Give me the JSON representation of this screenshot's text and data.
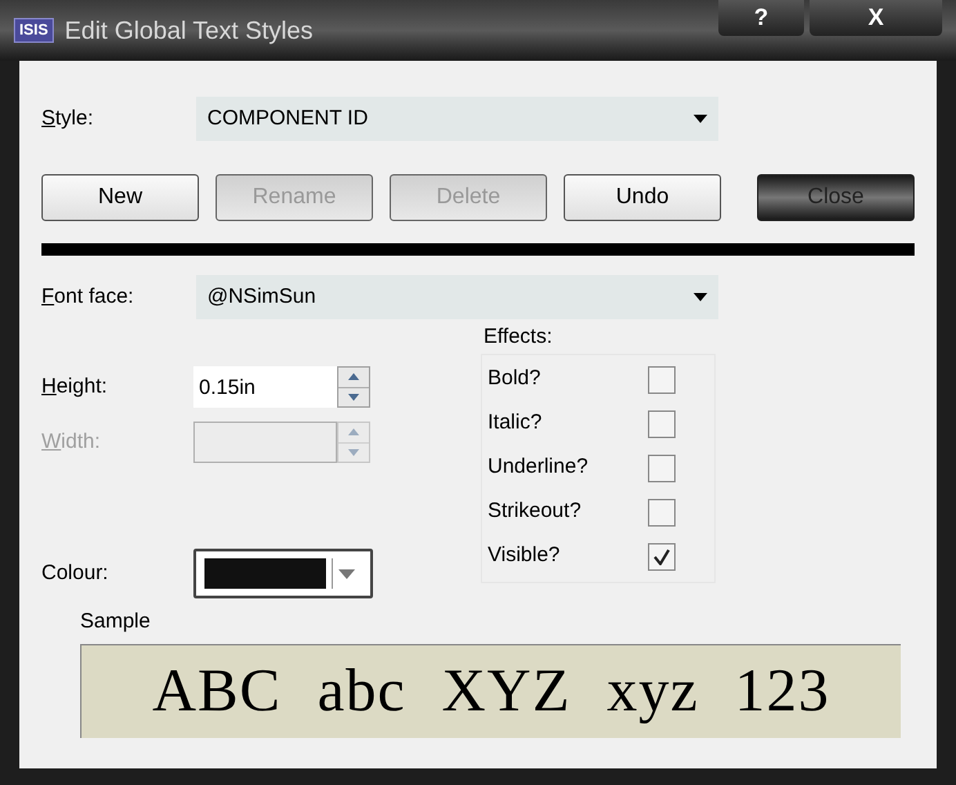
{
  "window": {
    "title": "Edit Global Text Styles",
    "logo": "ISIS",
    "help": "?",
    "close": "X"
  },
  "style": {
    "label": "Style:",
    "mnemonic": true,
    "value": "COMPONENT ID"
  },
  "buttons": [
    {
      "label": "New",
      "disabled": false,
      "focused": false
    },
    {
      "label": "Rename",
      "disabled": true,
      "focused": false
    },
    {
      "label": "Delete",
      "disabled": true,
      "focused": false
    },
    {
      "label": "Undo",
      "disabled": false,
      "focused": false
    },
    {
      "label": "Close",
      "disabled": false,
      "focused": true
    }
  ],
  "font_face": {
    "label": "Font face:",
    "mnemonic": true,
    "value": "@NSimSun"
  },
  "height": {
    "label": "Height:",
    "mnemonic": true,
    "value": "0.15in",
    "disabled": false
  },
  "width": {
    "label": "Width:",
    "mnemonic": true,
    "disabled": true
  },
  "colour": {
    "label": "Colour:",
    "mnemonic": false,
    "color": "#111111"
  },
  "effects": {
    "title": "Effects:",
    "items": [
      {
        "label": "Bold?",
        "checked": false
      },
      {
        "label": "Italic?",
        "checked": false
      },
      {
        "label": "Underline?",
        "checked": false
      },
      {
        "label": "Strikeout?",
        "checked": false
      },
      {
        "label": "Visible?",
        "checked": true
      }
    ]
  },
  "sample": {
    "label": "Sample",
    "text": "ABC abc XYZ xyz 123"
  }
}
